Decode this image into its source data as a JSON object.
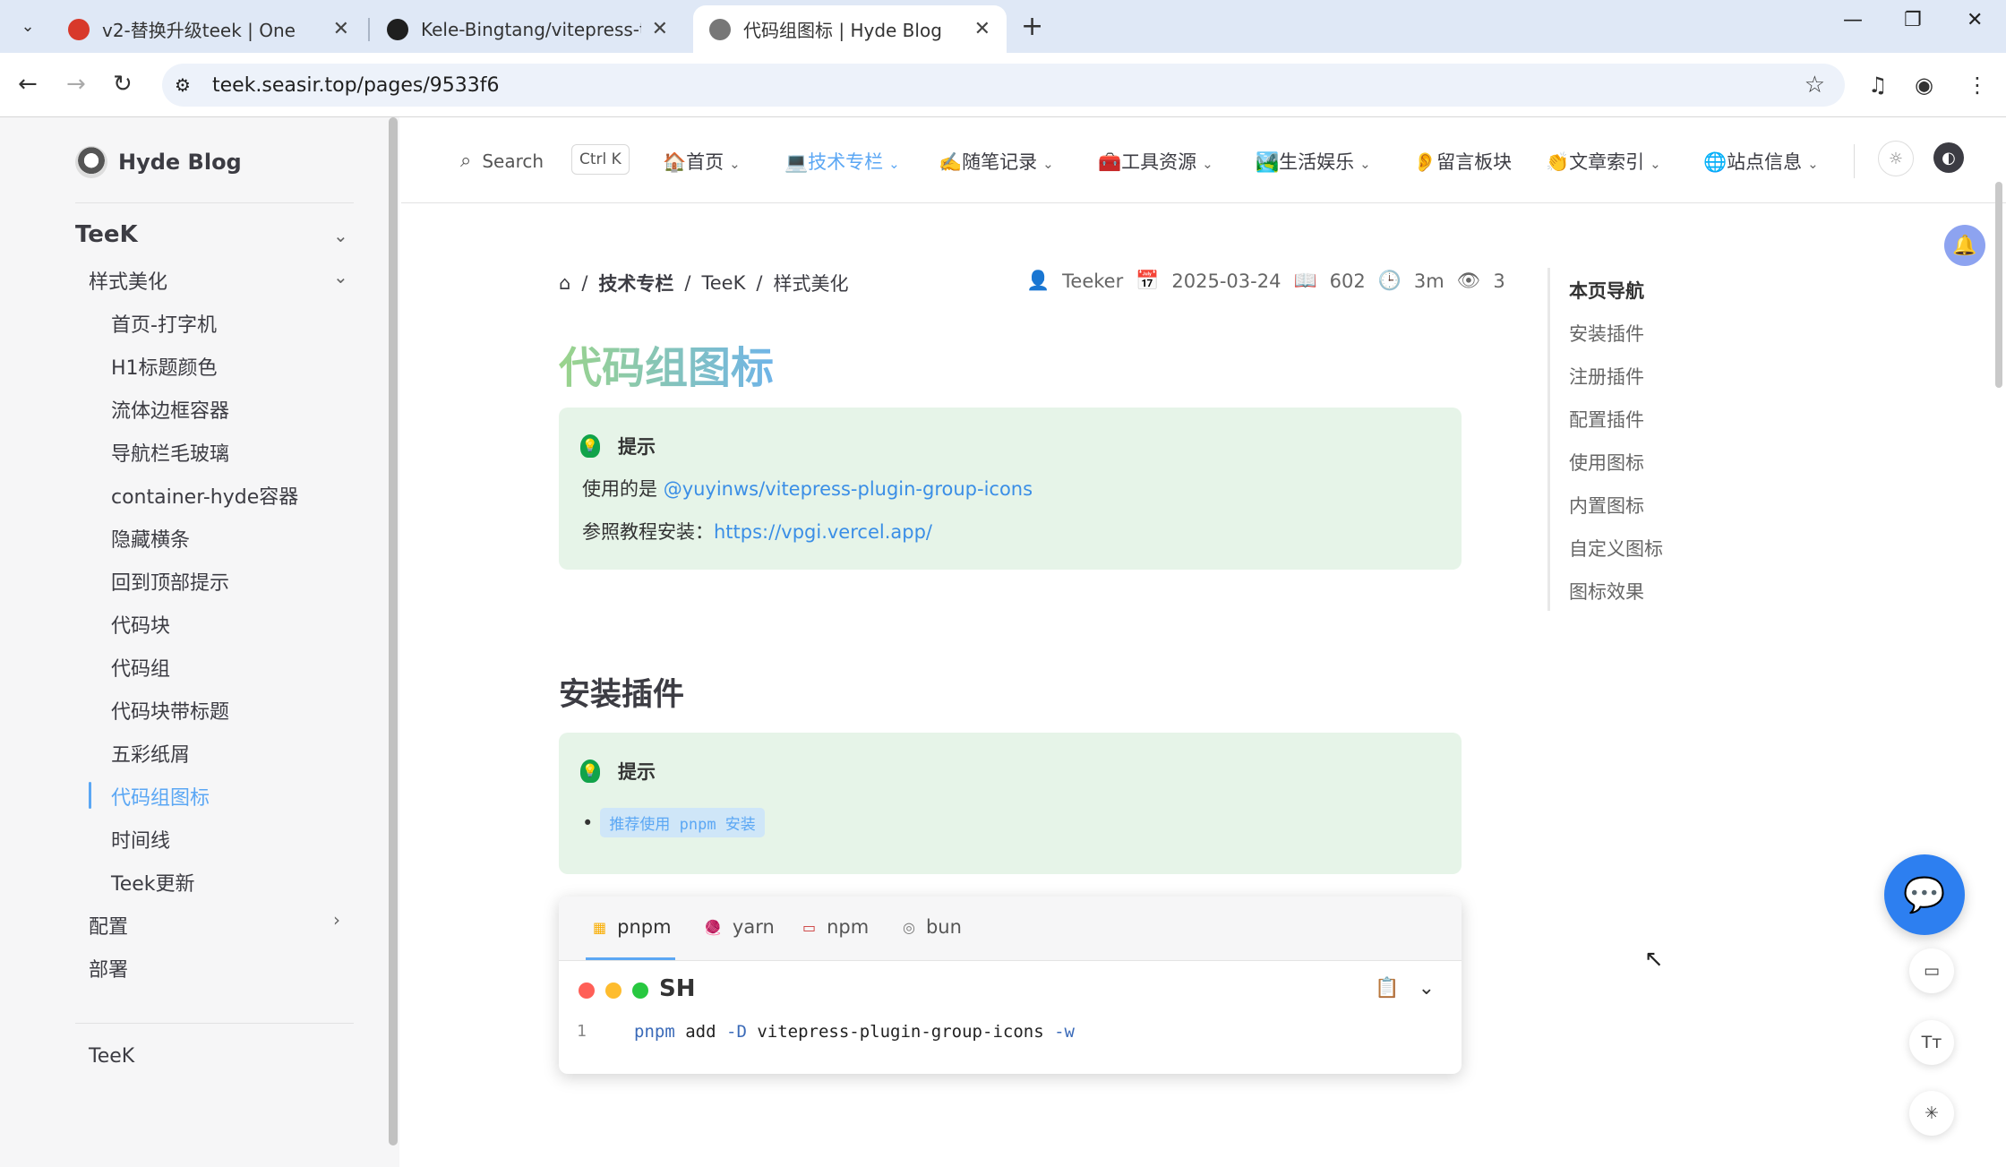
{
  "browser": {
    "tabs": [
      {
        "title": "v2-替换升级teek | One",
        "favicon_color": "#d8392b"
      },
      {
        "title": "Kele-Bingtang/vitepress-ther",
        "favicon_color": "#1f1f1f"
      },
      {
        "title": "代码组图标 | Hyde Blog",
        "favicon_color": "#777777"
      }
    ],
    "url": "teek.seasir.top/pages/9533f6"
  },
  "sidebar": {
    "brand": "Hyde Blog",
    "section": "TeeK",
    "group": "样式美化",
    "items": [
      "首页-打字机",
      "H1标题颜色",
      "流体边框容器",
      "导航栏毛玻璃",
      "container-hyde容器",
      "隐藏横条",
      "回到顶部提示",
      "代码块",
      "代码组",
      "代码块带标题",
      "五彩纸屑",
      "代码组图标",
      "时间线",
      "Teek更新"
    ],
    "active_item": "代码组图标",
    "config": "配置",
    "deploy": "部署",
    "footer": "TeeK"
  },
  "topnav": {
    "search_label": "Search",
    "shortcut": "Ctrl K",
    "items": [
      {
        "label": "🏠首页",
        "dropdown": true
      },
      {
        "label": "💻技术专栏",
        "dropdown": true
      },
      {
        "label": "✍️随笔记录",
        "dropdown": true
      },
      {
        "label": "🧰工具资源",
        "dropdown": true
      },
      {
        "label": "🏞️生活娱乐",
        "dropdown": true
      },
      {
        "label": "👂留言板块",
        "dropdown": false
      },
      {
        "label": "👏文章索引",
        "dropdown": true
      },
      {
        "label": "🌐站点信息",
        "dropdown": true
      }
    ],
    "active_item": "💻技术专栏"
  },
  "breadcrumb": [
    "技术专栏",
    "TeeK",
    "样式美化"
  ],
  "meta": {
    "author": "Teeker",
    "date": "2025-03-24",
    "words": "602",
    "read_time": "3m",
    "views": "3"
  },
  "doc": {
    "title": "代码组图标",
    "tip1": {
      "label": "提示",
      "line1_prefix": "使用的是 ",
      "line1_link": "@yuyinws/vitepress-plugin-group-icons",
      "line2_prefix": "参照教程安装：",
      "line2_link": "https://vpgi.vercel.app/"
    },
    "h2": "安装插件",
    "tip2": {
      "label": "提示",
      "bullet": "推荐使用 pnpm 安装"
    },
    "codegroup": {
      "tabs": [
        "pnpm",
        "yarn",
        "npm",
        "bun"
      ],
      "active_tab": "pnpm",
      "lang": "SH",
      "line_number": "1",
      "code": {
        "cmd": "pnpm",
        "sub": "add",
        "flag1": "-D",
        "pkg": "vitepress-plugin-group-icons",
        "flag2": "-w"
      }
    }
  },
  "outline": {
    "title": "本页导航",
    "items": [
      "安装插件",
      "注册插件",
      "配置插件",
      "使用图标",
      "内置图标",
      "自定义图标",
      "图标效果"
    ]
  },
  "colors": {
    "accent": "#5ba7f4",
    "tip_bg": "#e6f4e8",
    "link": "#3a8ee6",
    "fab": "#2d7ff0"
  }
}
